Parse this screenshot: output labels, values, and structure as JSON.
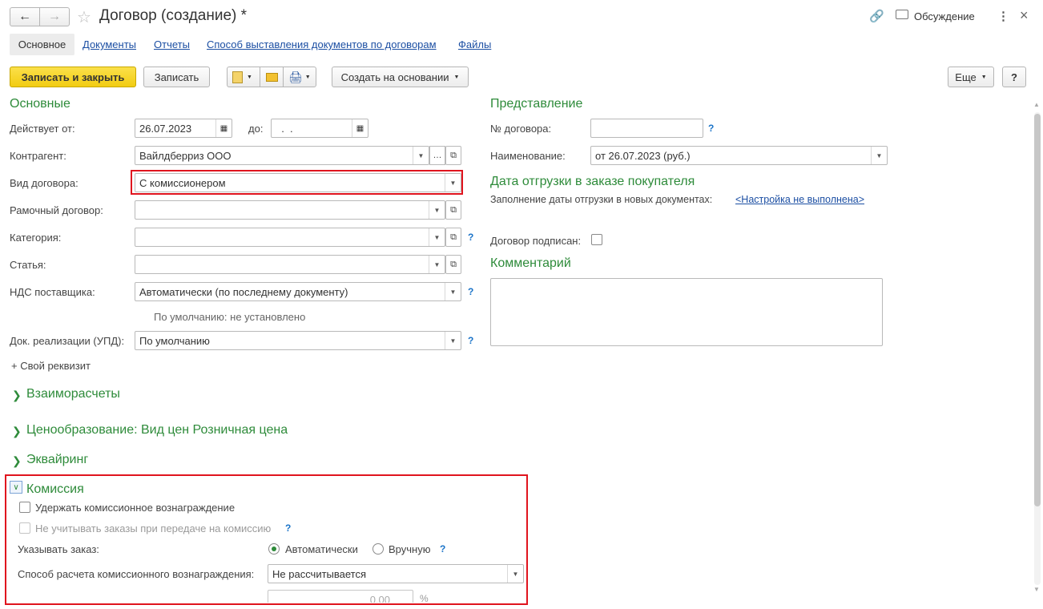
{
  "window": {
    "title": "Договор (создание) *",
    "discussion": "Обсуждение"
  },
  "tabs": [
    {
      "label": "Основное"
    },
    {
      "label": "Документы"
    },
    {
      "label": "Отчеты"
    },
    {
      "label": "Способ выставления документов по договорам"
    },
    {
      "label": "Файлы"
    }
  ],
  "toolbar": {
    "save_close": "Записать и закрыть",
    "save": "Записать",
    "create_based": "Создать на основании",
    "more": "Еще",
    "help": "?"
  },
  "main": {
    "title": "Основные",
    "valid_from_label": "Действует от:",
    "valid_from_value": "26.07.2023",
    "valid_to_label": "до:",
    "valid_to_value": "  .  .",
    "counterparty_label": "Контрагент:",
    "counterparty_value": "Вайлдберриз ООО",
    "contract_type_label": "Вид договора:",
    "contract_type_value": "С комиссионером",
    "frame_label": "Рамочный договор:",
    "frame_value": "",
    "category_label": "Категория:",
    "category_value": "",
    "article_label": "Статья:",
    "article_value": "",
    "vat_label": "НДС поставщика:",
    "vat_value": "Автоматически (по последнему документу)",
    "vat_note": "По умолчанию: не установлено",
    "doc_label": "Док. реализации (УПД):",
    "doc_value": "По умолчанию",
    "custom_attr": "+ Свой реквизит"
  },
  "right": {
    "title": "Представление",
    "num_label": "№ договора:",
    "num_value": "",
    "name_label": "Наименование:",
    "name_value": "от 26.07.2023 (руб.)",
    "ship_title": "Дата отгрузки в заказе покупателя",
    "ship_label": "Заполнение даты отгрузки в новых документах:",
    "ship_link": "<Настройка не выполнена>",
    "signed_label": "Договор подписан:",
    "comment_title": "Комментарий"
  },
  "groups": {
    "settlements": "Взаиморасчеты",
    "pricing": "Ценообразование: Вид цен Розничная цена",
    "acquiring": "Эквайринг",
    "commission": "Комиссия"
  },
  "commission": {
    "hold_label": "Удержать комиссионное вознаграждение",
    "ignore_label": "Не учитывать заказы при передаче на комиссию",
    "order_label": "Указывать заказ:",
    "auto_label": "Автоматически",
    "manual_label": "Вручную",
    "calc_label": "Способ расчета комиссионного вознаграждения:",
    "calc_value": "Не рассчитывается",
    "percent_value": "0,00",
    "percent_unit": "%"
  },
  "colors": {
    "accent_green": "#2e8b3a",
    "highlight_red": "#e0141e",
    "primary_button": "#f7d51f",
    "link": "#1c4fa3"
  }
}
